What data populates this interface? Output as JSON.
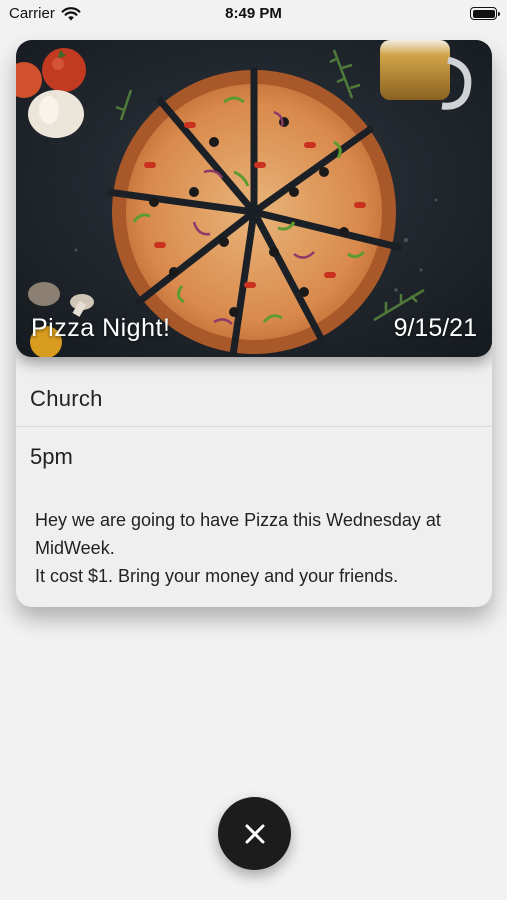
{
  "status_bar": {
    "carrier": "Carrier",
    "time": "8:49 PM",
    "wifi_icon": "wifi-icon",
    "battery_icon": "battery-icon",
    "battery_level": 1.0
  },
  "event": {
    "title": "Pizza Night!",
    "date": "9/15/21",
    "location": "Church",
    "time": "5pm",
    "description": "Hey we are going to have Pizza this Wednesday at MidWeek.\nIt cost $1. Bring your money and your friends.",
    "image": "pizza-photo"
  },
  "close_button": {
    "icon": "close-icon",
    "color": "#1c1c1c"
  },
  "colors": {
    "background": "#f2f2f2",
    "card": "#efefef",
    "text": "#222222"
  }
}
